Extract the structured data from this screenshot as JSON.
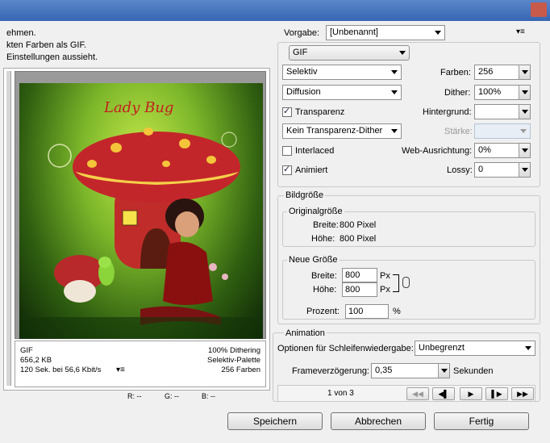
{
  "messages": [
    "ehmen.",
    "kten Farben als GIF.",
    "Einstellungen aussieht."
  ],
  "info": {
    "format": "GIF",
    "size": "656,2 KB",
    "time": "120 Sek. bei 56,6 Kbit/s",
    "dithering": "100% Dithering",
    "palette": "Selektiv-Palette",
    "colors": "256 Farben"
  },
  "readout": {
    "r": "R: --",
    "g": "G: --",
    "b": "B: --"
  },
  "preset": {
    "label": "Vorgabe:",
    "value": "[Unbenannt]"
  },
  "format": "GIF",
  "settings": {
    "reduction": "Selektiv",
    "dither_algo": "Diffusion",
    "transparency_label": "Transparenz",
    "transparency_dither": "Kein Transparenz-Dither",
    "interlaced_label": "Interlaced",
    "animated_label": "Animiert",
    "colors_label": "Farben:",
    "colors_value": "256",
    "dither_label": "Dither:",
    "dither_value": "100%",
    "matte_label": "Hintergrund:",
    "matte_value": "",
    "amount_label": "Stärke:",
    "amount_value": "",
    "web_label": "Web-Ausrichtung:",
    "web_value": "0%",
    "lossy_label": "Lossy:",
    "lossy_value": "0"
  },
  "image_size": {
    "title": "Bildgröße",
    "original_title": "Originalgröße",
    "width_label": "Breite:",
    "width_value": "800 Pixel",
    "height_label": "Höhe:",
    "height_value": "800 Pixel",
    "new_title": "Neue Größe",
    "new_width_label": "Breite:",
    "new_width_value": "800",
    "new_height_label": "Höhe:",
    "new_height_value": "800",
    "unit": "Px",
    "percent_label": "Prozent:",
    "percent_value": "100",
    "percent_unit": "%"
  },
  "animation": {
    "title": "Animation",
    "loop_label": "Optionen für Schleifenwiedergabe:",
    "loop_value": "Unbegrenzt",
    "delay_label": "Frameverzögerung:",
    "delay_value": "0,35",
    "delay_unit": "Sekunden",
    "frame_counter": "1 von 3"
  },
  "buttons": {
    "save": "Speichern",
    "cancel": "Abbrechen",
    "done": "Fertig"
  },
  "image_text": "Lady Bug",
  "colors": {
    "titlebar": "#3766b3",
    "bg": "#f0f0f0"
  }
}
